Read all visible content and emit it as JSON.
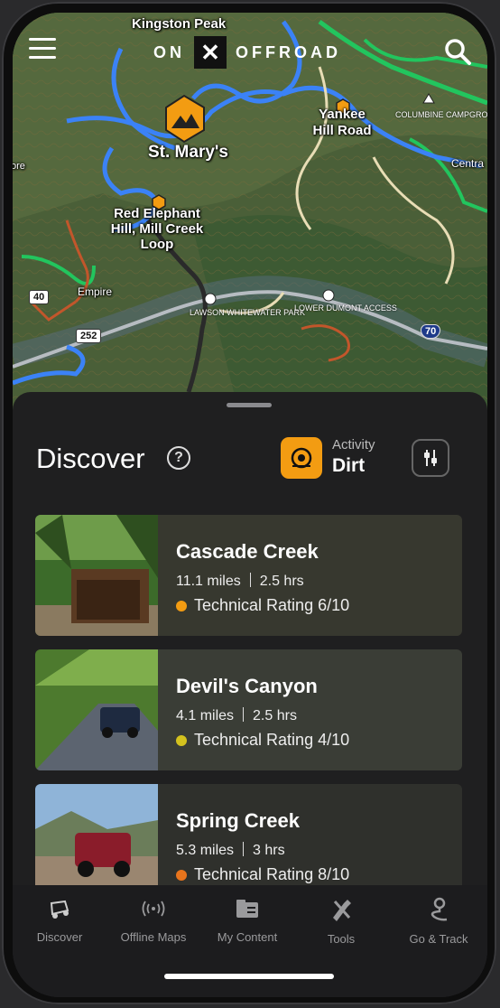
{
  "app": {
    "brand_left": "ON",
    "brand_x": "✕",
    "brand_right": "OFFROAD"
  },
  "map": {
    "labels": {
      "kingston_peak": "Kingston Peak",
      "st_marys": "St. Mary's",
      "yankee_hill": "Yankee Hill Road",
      "red_elephant": "Red Elephant Hill, Mill Creek Loop",
      "empire": "Empire",
      "columbine": "COLUMBINE CAMPGROUND",
      "lawson": "LAWSON WHITEWATER PARK",
      "lower_dumont": "LOWER DUMONT ACCESS",
      "centra": "Centra",
      "empire_left": "Empire",
      "more_left": "ore"
    },
    "highways": [
      "40",
      "252",
      "70"
    ]
  },
  "discover": {
    "title": "Discover",
    "help": "?",
    "activity_caption": "Activity",
    "activity_value": "Dirt"
  },
  "trails": [
    {
      "name": "Cascade Creek",
      "distance": "11.1 miles",
      "duration": "2.5 hrs",
      "rating": "Technical Rating 6/10",
      "rating_color": "#f39c12"
    },
    {
      "name": "Devil's Canyon",
      "distance": "4.1 miles",
      "duration": "2.5 hrs",
      "rating": "Technical Rating 4/10",
      "rating_color": "#d4c21e"
    },
    {
      "name": "Spring Creek",
      "distance": "5.3 miles",
      "duration": "3 hrs",
      "rating": "Technical Rating 8/10",
      "rating_color": "#e8741c"
    }
  ],
  "tabs": [
    {
      "label": "Discover",
      "icon": "jeep-icon"
    },
    {
      "label": "Offline Maps",
      "icon": "broadcast-icon"
    },
    {
      "label": "My Content",
      "icon": "folder-icon"
    },
    {
      "label": "Tools",
      "icon": "tools-icon"
    },
    {
      "label": "Go & Track",
      "icon": "route-pin-icon"
    }
  ],
  "colors": {
    "accent": "#f39c12",
    "trail_blue": "#3b82f6",
    "trail_green": "#22c55e"
  }
}
